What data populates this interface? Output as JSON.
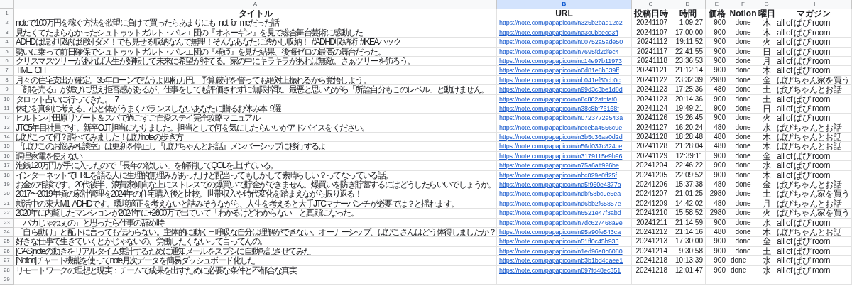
{
  "column_headers": [
    {
      "label": "A",
      "selected": false
    },
    {
      "label": "B",
      "selected": true
    },
    {
      "label": "C",
      "selected": false
    },
    {
      "label": "D",
      "selected": false
    },
    {
      "label": "E",
      "selected": false
    },
    {
      "label": "F",
      "selected": false
    },
    {
      "label": "G",
      "selected": false
    },
    {
      "label": "H",
      "selected": false
    }
  ],
  "header_row": {
    "number": "1",
    "cells": [
      "タイトル",
      "URL",
      "投稿日時",
      "時間",
      "価格",
      "Notion",
      "曜日",
      "マガジン"
    ]
  },
  "rows": [
    {
      "number": "2",
      "title": "noteで100万円を稼ぐ方法を欲望に負けて買ったらあまりにも not for meだった話",
      "url": "https://note.com/papapico/n/n325b2bad12c2",
      "date": "20241107",
      "time": "1:09:27",
      "price": "900",
      "notion": "done",
      "notion_centered": true,
      "weekday": "木",
      "magazine": "all of ぱぴ room"
    },
    {
      "number": "3",
      "title": "見たくてたまらなかったシュトゥットガルト・バレエ団の『オネーギン』を見て総合舞台芸術に感動した",
      "url": "https://note.com/papapico/n/na3c0bbece3ff",
      "date": "20241107",
      "time": "17:00:00",
      "price": "900",
      "notion": "done",
      "notion_centered": true,
      "weekday": "木",
      "magazine": "all of ぱぴ room"
    },
    {
      "number": "4",
      "title": "ADHDは隠す収納は絶対ダメ！でも見せる収納なんて無理！そんなあなたに透かし収納！ #ADHD収納術 #IKEAハック",
      "url": "https://note.com/papapico/n/n00752a5ade50",
      "date": "20241112",
      "time": "19:11:52",
      "price": "900",
      "notion": "done",
      "notion_centered": true,
      "weekday": "火",
      "magazine": "all of ぱぴ room"
    },
    {
      "number": "5",
      "title": "勢いに乗って前日確保でシュトゥットガルト・バレエ団の『椿姫』を見た結果、後悔ゼロの最高の舞台だった。",
      "url": "https://note.com/papapico/n/n7695fd2dfec4",
      "date": "20241117",
      "time": "22:41:55",
      "price": "900",
      "notion": "done",
      "notion_centered": true,
      "weekday": "日",
      "magazine": "all of ぱぴ room"
    },
    {
      "number": "6",
      "title": "クリスマスツリーがあれば人生が好転して未来に希望が持てる。家の中にキラキラがあれば無敵。さぁツリーを飾ろう。",
      "url": "https://note.com/papapico/n/nc14e97b11973",
      "date": "20241118",
      "time": "23:36:53",
      "price": "900",
      "notion": "done",
      "notion_centered": true,
      "weekday": "月",
      "magazine": "all of ぱぴ room"
    },
    {
      "number": "7",
      "title": "TIME OFF",
      "url": "https://note.com/papapico/n/n0d81e8b339ff",
      "date": "20241121",
      "time": "21:12:14",
      "price": "900",
      "notion": "done",
      "notion_centered": true,
      "weekday": "木",
      "magazine": "all of ぱぴ room"
    },
    {
      "number": "8",
      "title": "月々の住宅支出が確定。35年ローンで払うよ四桁万円。予算厳守を誓っても絶対上振れるから覚悟しよう。",
      "url": "https://note.com/papapico/n/nb041ef50cb0c",
      "date": "20241122",
      "time": "23:32:39",
      "price": "2980",
      "notion": "done",
      "notion_centered": true,
      "weekday": "金",
      "magazine": "ぱぴちゃん家を買う"
    },
    {
      "number": "9",
      "title": "「顔を売る」が媚びに思え拒否感があるが、仕事をしても評価されずに無限搾取。最悪と思いながら「所詮自分もこのレベル」と動けません。",
      "url": "https://note.com/papapico/n/n99d3c3be1d8d",
      "date": "20241123",
      "time": "17:25:36",
      "price": "480",
      "notion": "done",
      "notion_centered": true,
      "weekday": "土",
      "magazine": "ぱぴちゃんとお話"
    },
    {
      "number": "10",
      "title": "タロット占いに行ってきた。 7",
      "url": "https://note.com/papapico/n/n8c862afdfaf0",
      "date": "20241123",
      "time": "20:14:36",
      "price": "900",
      "notion": "done",
      "notion_centered": true,
      "weekday": "土",
      "magazine": "all of ぱぴ room"
    },
    {
      "number": "11",
      "title": "休むを真剣に考える。心と体がうまくバランスしないあなたに贈るお休み本 9選",
      "url": "https://note.com/papapico/n/n38c8bf76168f",
      "date": "20241124",
      "time": "19:49:21",
      "price": "900",
      "notion": "done",
      "notion_centered": true,
      "weekday": "日",
      "magazine": "all of ぱぴ room"
    },
    {
      "number": "12",
      "title": "ヒルトン小田原リゾート＆スパで過ごすご自愛ステイ完全攻略マニュアル",
      "url": "https://note.com/papapico/n/n0723772e543a",
      "date": "20241126",
      "time": "19:26:45",
      "price": "900",
      "notion": "done",
      "notion_centered": true,
      "weekday": "火",
      "magazine": "all of ぱぴ room"
    },
    {
      "number": "13",
      "title": "JTC5年目社員です。新卒OJT担当になりました。担当として何を気にしたらいいかアドバイスをください。",
      "url": "https://note.com/papapico/n/neceba4556c9e",
      "date": "20241127",
      "time": "16:20:24",
      "price": "480",
      "notion": "done",
      "notion_centered": true,
      "weekday": "水",
      "magazine": "ぱぴちゃんとお話"
    },
    {
      "number": "14",
      "title": "ぱぴこって何？調べてみました！ぱぴnoteの歩き方",
      "url": "https://note.com/papapico/n/n3b5c36aa0d2d",
      "date": "20241128",
      "time": "18:28:48",
      "price": "480",
      "notion": "done",
      "notion_centered": true,
      "weekday": "木",
      "magazine": "ぱぴちゃんとお話"
    },
    {
      "number": "15",
      "title": "『ぱぴこのお悩み相談室』は更新を停止し『ぱぴちゃんとお話』メンバーシップに移行するよ",
      "url": "https://note.com/papapico/n/n56d037c824ce",
      "date": "20241128",
      "time": "21:28:04",
      "price": "480",
      "notion": "done",
      "notion_centered": true,
      "weekday": "木",
      "magazine": "ぱぴちゃんとお話"
    },
    {
      "number": "16",
      "title": "調理家電を使えない",
      "url": "https://note.com/papapico/n/n3179115e9b96",
      "date": "20241129",
      "time": "12:39:11",
      "price": "900",
      "notion": "done",
      "notion_centered": true,
      "weekday": "金",
      "magazine": "all of ぱぴ room"
    },
    {
      "number": "17",
      "title": "泡銭120万円が手に入ったので「長年の欲しい」を解消してQOLを上げている。",
      "url": "https://note.com/papapico/n/n75a6aff926be",
      "date": "20241204",
      "time": "22:46:22",
      "price": "900",
      "notion": "done",
      "notion_centered": true,
      "weekday": "水",
      "magazine": "all of ぱぴ room"
    },
    {
      "number": "18",
      "title": "インターネットでFIREを語る人に生理的無理みがあったけど配当ってもしかして素晴らしい？ってなっている話。",
      "url": "https://note.com/papapico/n/nbc029e0ff25f",
      "date": "20241205",
      "time": "22:09:52",
      "price": "900",
      "notion": "done",
      "notion_centered": true,
      "weekday": "木",
      "magazine": "all of ぱぴ room"
    },
    {
      "number": "19",
      "title": "お金の相談です。20代後半、浪費家傾向な上にストレスでの爆買いで貯金ができません。爆買いを防ぎ貯蓄するにはどうしたらいいでしょうか。",
      "url": "https://note.com/papapico/n/na5f950e4377a",
      "date": "20241206",
      "time": "15:37:38",
      "price": "480",
      "notion": "done",
      "notion_centered": true,
      "weekday": "金",
      "magazine": "ぱぴちゃんとお話"
    },
    {
      "number": "20",
      "title": "2017〜2019年頃の家計管理を2024年の住宅購入後と比較。世帯収入や時代変化を踏まえながら振り返る！",
      "url": "https://note.com/papapico/n/ndbf58bc9e5ea",
      "date": "20241207",
      "time": "21:01:25",
      "price": "2980",
      "notion": "done",
      "notion_centered": true,
      "weekday": "土",
      "magazine": "ぱぴちゃん家を買う"
    },
    {
      "number": "21",
      "title": "就活中の東大M1 ADHDです。環境適正を考えないと詰みそうながら、人生を考えると大手JTCマナーパンチが必要では？と揺れます。",
      "url": "https://note.com/papapico/n/nd6bb2f65857e",
      "date": "20241209",
      "time": "14:42:02",
      "price": "480",
      "notion": "done",
      "notion_centered": true,
      "weekday": "月",
      "magazine": "ぱぴちゃんとお話"
    },
    {
      "number": "22",
      "title": "2020年に内覧したマンションが2024年に+2600万で出ていて「わかるけどわからない」と真顔になった。",
      "url": "https://note.com/papapico/n/n6521e47f3abd",
      "date": "20241210",
      "time": "15:58:52",
      "price": "2980",
      "notion": "done",
      "notion_centered": true,
      "weekday": "火",
      "magazine": "ぱぴちゃん家を買う"
    },
    {
      "number": "23",
      "title": "「バカじゃねぇの」と思ったら仕事の辞め時",
      "url": "https://note.com/papapico/n/n7dc627468a9e",
      "date": "20241211",
      "time": "21:14:59",
      "price": "900",
      "notion": "done",
      "notion_centered": true,
      "weekday": "水",
      "magazine": "all of ぱぴ room"
    },
    {
      "number": "24",
      "title": "「自ら動け」と配下に言っても伝わらない。主体的に動く＝呼吸な自分は理解ができない。オーナーシップ、ぱぴこさんはどう体得しましたか？",
      "url": "https://note.com/papapico/n/n95a90fe543ca",
      "date": "20241212",
      "time": "21:14:16",
      "price": "480",
      "notion": "done",
      "notion_centered": true,
      "weekday": "木",
      "magazine": "ぱぴちゃんとお話"
    },
    {
      "number": "25",
      "title": "好きな仕事で生きていくとかじゃないの、労働したくないって言ってんの。",
      "url": "https://note.com/papapico/n/n51ff0c45b933",
      "date": "20241213",
      "time": "17:30:00",
      "price": "900",
      "notion": "done",
      "notion_centered": true,
      "weekday": "金",
      "magazine": "all of ぱぴ room"
    },
    {
      "number": "26",
      "title": "[GAS]noteの動きをリアルタイム集計するために通知メールをスプシに自動転記させてみた",
      "url": "https://note.com/papapico/n/n1ed96a0c6080",
      "date": "20241214",
      "time": "9:30:58",
      "price": "900",
      "notion": "done",
      "notion_centered": true,
      "weekday": "土",
      "magazine": "all of ぱぴ room"
    },
    {
      "number": "27",
      "title": "[Notion]チャート機能を使ってnote月次データを簡易ダッシュボード化した",
      "url": "https://note.com/papapico/n/nb3b1bd4daee1",
      "date": "20241218",
      "time": "10:13:39",
      "price": "900",
      "notion": "done",
      "notion_centered": false,
      "weekday": "水",
      "magazine": "all of ぱぴ room"
    },
    {
      "number": "28",
      "title": "リモートワークの理想と現実：チームで成果を出すために必要な条件と不都合な真実",
      "url": "https://note.com/papapico/n/n897fd48ec351",
      "date": "20241218",
      "time": "12:01:47",
      "price": "900",
      "notion": "done",
      "notion_centered": false,
      "weekday": "水",
      "magazine": "all of ぱぴ room"
    }
  ],
  "empty_rows": [
    {
      "number": "29"
    }
  ]
}
